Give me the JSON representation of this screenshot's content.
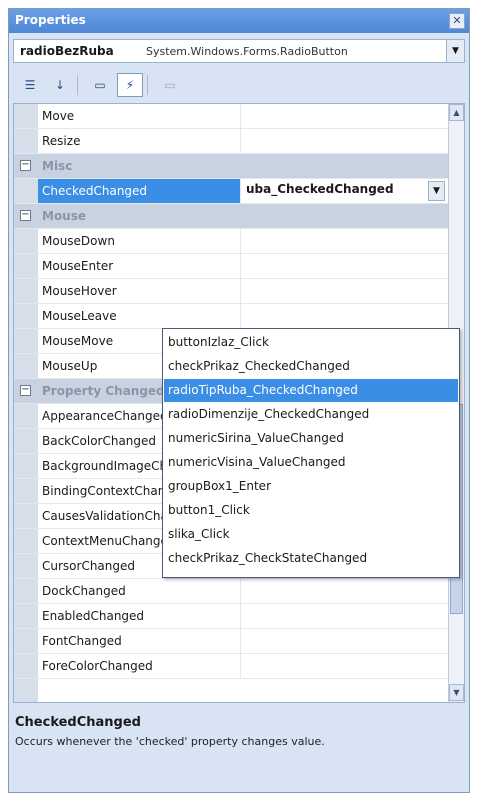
{
  "window": {
    "title": "Properties",
    "close_glyph": "✕"
  },
  "object_selector": {
    "name": "radioBezRuba",
    "type": "System.Windows.Forms.RadioButton",
    "drop_glyph": "▼"
  },
  "toolbar": {
    "buttons": [
      {
        "name": "categorized-icon",
        "glyph": "☰",
        "active": false
      },
      {
        "name": "alphabetical-icon",
        "glyph": "↓",
        "active": false
      },
      {
        "name": "properties-icon",
        "glyph": "▭",
        "active": false
      },
      {
        "name": "events-icon",
        "glyph": "⚡",
        "active": true
      },
      {
        "name": "property-pages-icon",
        "glyph": "▭",
        "active": false,
        "disabled": true
      }
    ]
  },
  "grid": {
    "rows": [
      {
        "label": "Move",
        "type": "prop"
      },
      {
        "label": "Resize",
        "type": "prop"
      },
      {
        "label": "Misc",
        "type": "cat",
        "exp": "−"
      },
      {
        "label": "CheckedChanged",
        "type": "sel",
        "value": "uba_CheckedChanged"
      },
      {
        "label": "Mouse",
        "type": "cat",
        "exp": "−"
      },
      {
        "label": "MouseDown",
        "type": "prop"
      },
      {
        "label": "MouseEnter",
        "type": "prop"
      },
      {
        "label": "MouseHover",
        "type": "prop"
      },
      {
        "label": "MouseLeave",
        "type": "prop"
      },
      {
        "label": "MouseMove",
        "type": "prop"
      },
      {
        "label": "MouseUp",
        "type": "prop"
      },
      {
        "label": "Property Changed",
        "type": "cat",
        "exp": "−"
      },
      {
        "label": "AppearanceChanged",
        "type": "prop"
      },
      {
        "label": "BackColorChanged",
        "type": "prop"
      },
      {
        "label": "BackgroundImageChanged",
        "type": "prop"
      },
      {
        "label": "BindingContextChanged",
        "type": "prop"
      },
      {
        "label": "CausesValidationChanged",
        "type": "prop"
      },
      {
        "label": "ContextMenuChanged",
        "type": "prop"
      },
      {
        "label": "CursorChanged",
        "type": "prop"
      },
      {
        "label": "DockChanged",
        "type": "prop"
      },
      {
        "label": "EnabledChanged",
        "type": "prop"
      },
      {
        "label": "FontChanged",
        "type": "prop"
      },
      {
        "label": "ForeColorChanged",
        "type": "prop"
      }
    ],
    "value_drop_glyph": "▼",
    "scroll_up_glyph": "▲",
    "scroll_down_glyph": "▼"
  },
  "dropdown": {
    "items": [
      {
        "label": "buttonIzlaz_Click",
        "selected": false
      },
      {
        "label": "checkPrikaz_CheckedChanged",
        "selected": false
      },
      {
        "label": "radioTipRuba_CheckedChanged",
        "selected": true
      },
      {
        "label": "radioDimenzije_CheckedChanged",
        "selected": false
      },
      {
        "label": "numericSirina_ValueChanged",
        "selected": false
      },
      {
        "label": "numericVisina_ValueChanged",
        "selected": false
      },
      {
        "label": "groupBox1_Enter",
        "selected": false
      },
      {
        "label": "button1_Click",
        "selected": false
      },
      {
        "label": "slika_Click",
        "selected": false
      },
      {
        "label": "checkPrikaz_CheckStateChanged",
        "selected": false
      }
    ]
  },
  "description": {
    "title": "CheckedChanged",
    "text": "Occurs whenever the 'checked' property changes value."
  }
}
